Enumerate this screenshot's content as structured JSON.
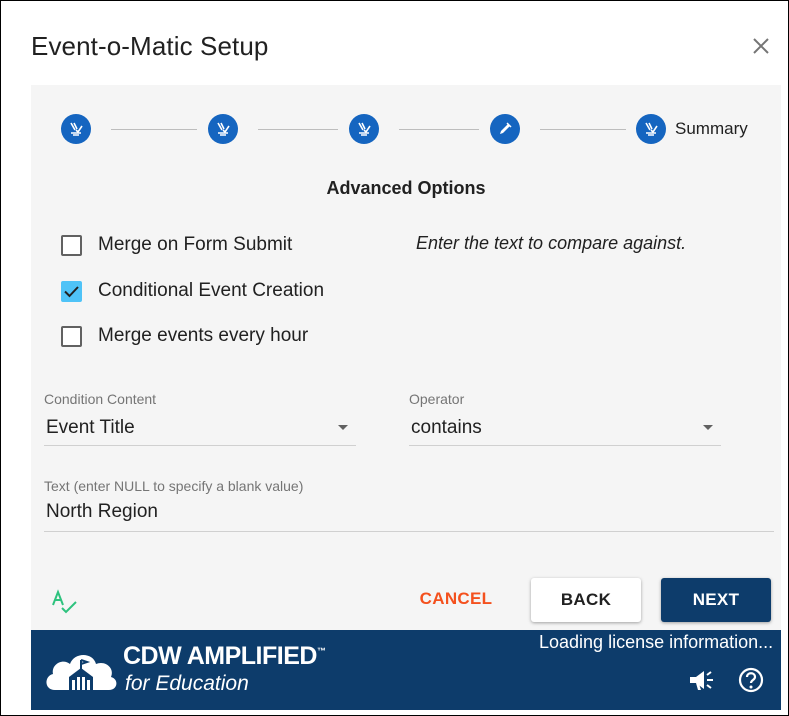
{
  "dialog": {
    "title": "Event-o-Matic Setup",
    "close_icon": "close-icon"
  },
  "stepper": {
    "steps": [
      {
        "icon": "wand-check-icon",
        "label": ""
      },
      {
        "icon": "wand-check-icon",
        "label": ""
      },
      {
        "icon": "wand-check-icon",
        "label": ""
      },
      {
        "icon": "pencil-icon",
        "label": ""
      },
      {
        "icon": "wand-check-icon",
        "label": "Summary"
      }
    ],
    "color": "#1565c0"
  },
  "section": {
    "title": "Advanced Options"
  },
  "options": {
    "merge_on_submit": {
      "label": "Merge on Form Submit",
      "checked": false
    },
    "conditional_event": {
      "label": "Conditional Event Creation",
      "checked": true
    },
    "merge_hourly": {
      "label": "Merge events every hour",
      "checked": false
    }
  },
  "hint": "Enter the text to compare against.",
  "condition_content": {
    "label": "Condition Content",
    "value": "Event Title"
  },
  "operator": {
    "label": "Operator",
    "value": "contains"
  },
  "text_field": {
    "label": "Text (enter NULL to specify a blank value)",
    "value": "North Region"
  },
  "actions": {
    "spellcheck_icon": "spellcheck-icon",
    "cancel": "CANCEL",
    "back": "BACK",
    "next": "NEXT"
  },
  "footer": {
    "brand": "CDW AMPLIFIED",
    "trademark": "™",
    "subtitle": "for Education",
    "status": "Loading license information...",
    "announce_icon": "megaphone-icon",
    "help_icon": "help-circle-icon",
    "color": "#0d3c6b"
  },
  "colors": {
    "accent": "#1565c0",
    "checkbox_checked": "#4fc3f7",
    "cancel": "#f4511e",
    "spellcheck": "#2ec27e"
  }
}
